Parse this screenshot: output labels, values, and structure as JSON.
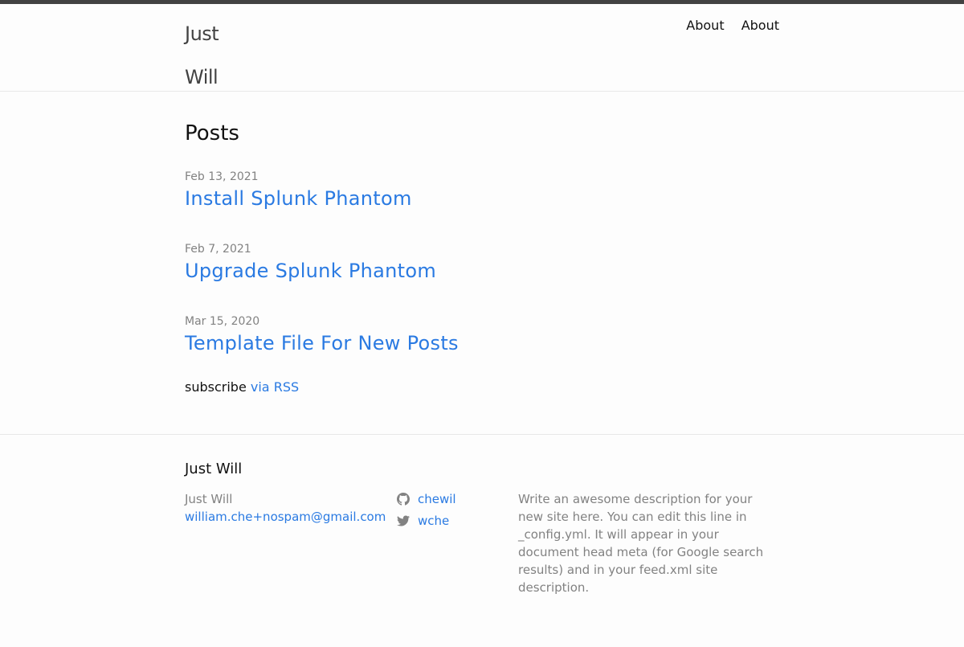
{
  "header": {
    "site_title": "Just Will",
    "nav": [
      {
        "label": "About"
      },
      {
        "label": "About"
      }
    ]
  },
  "main": {
    "heading": "Posts",
    "posts": [
      {
        "date": "Feb 13, 2021",
        "title": "Install Splunk Phantom"
      },
      {
        "date": "Feb 7, 2021",
        "title": "Upgrade Splunk Phantom"
      },
      {
        "date": "Mar 15, 2020",
        "title": "Template File For New Posts"
      }
    ],
    "subscribe_text": "subscribe",
    "subscribe_link": "via RSS"
  },
  "footer": {
    "heading": "Just Will",
    "name": "Just Will",
    "email": "william.che+nospam@gmail.com",
    "social": [
      {
        "icon": "github-icon",
        "label": "chewil"
      },
      {
        "icon": "twitter-icon",
        "label": "wche"
      }
    ],
    "description": "Write an awesome description for your new site here. You can edit this line in _config.yml. It will appear in your document head meta (for Google search results) and in your feed.xml site description."
  },
  "colors": {
    "link": "#2a7ae2",
    "meta": "#828282",
    "top_bar": "#424242"
  }
}
